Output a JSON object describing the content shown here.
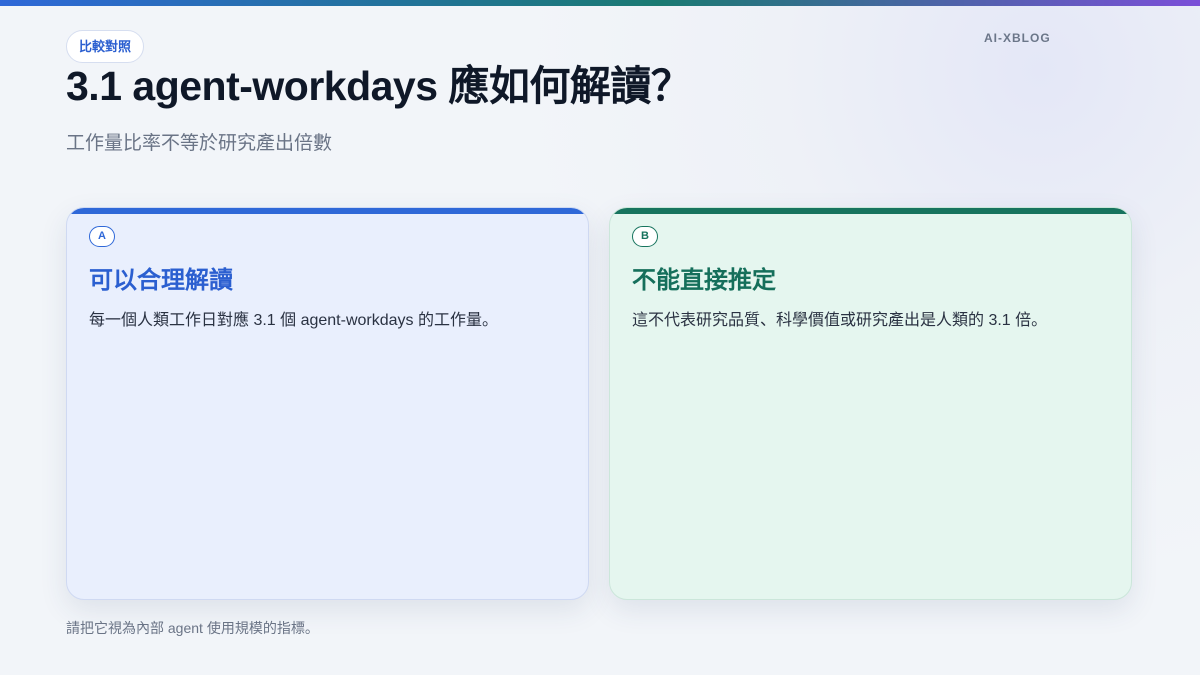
{
  "tag": "比較對照",
  "brand": "AI-XBLOG",
  "title": "3.1 agent-workdays 應如何解讀？",
  "subtitle": "工作量比率不等於研究產出倍數",
  "cards": [
    {
      "badge": "A",
      "title": "可以合理解讀",
      "body": "每一個人類工作日對應 3.1 個 agent-workdays 的工作量。",
      "accent": "#2f68d8"
    },
    {
      "badge": "B",
      "title": "不能直接推定",
      "body": "這不代表研究品質、科學價值或研究產出是人類的 3.1 倍。",
      "accent": "#17745e"
    }
  ],
  "footnote": "請把它視為內部 agent 使用規模的指標。"
}
